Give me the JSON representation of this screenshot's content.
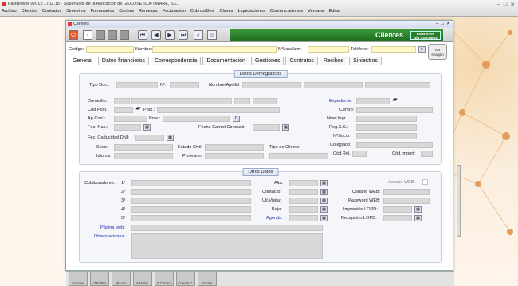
{
  "app": {
    "title": "FastBroker v2012.1702.15 - Supervisor de la Aplicación de GECOSE SOFTWARE, S.L.",
    "menu": [
      "Archivo",
      "Clientes",
      "Contratos",
      "Siniestros",
      "Formularios",
      "Cartera",
      "Remesas",
      "Facturación",
      "Cobros/Dev.",
      "Claves",
      "Liquidaciones",
      "Comunicaciones",
      "Ventana",
      "Editar"
    ]
  },
  "window": {
    "title": "Clientes",
    "header_label": "Clientes",
    "badge_line1": "Existentes",
    "badge_line2": "Sin Contratos",
    "photo_label_1": "Sin",
    "photo_label_2": "Imagen"
  },
  "top_fields": {
    "codigo": "Código:",
    "nombre": "Nombre:",
    "nlocalizacion": "NºLocalizm:",
    "telefono": "Teléfono:"
  },
  "tabs": [
    "General",
    "Datos financieros",
    "Correspondencia",
    "Documentación",
    "Gestiones",
    "Contratos",
    "Recibos",
    "Siniestros"
  ],
  "demograficos": {
    "title": "Datos Demográficos",
    "tipo_doc": "Tipo Doc.:",
    "n": "Nº:",
    "nombre_apellido": "Nombre/Apellid",
    "domicilio": "Domicilio:",
    "cod_post": "Cod Post.:",
    "pobl": "Pobl.:",
    "ap_corr": "Ap.Corr.:",
    "prov": "Prov.:",
    "fec_nac": "Fec. Nac.:",
    "fecha_carnet": "Fecha Carnet Conducir:",
    "fec_caducidad": "Fec. Caducidad DNI:",
    "sexo": "Sexo:",
    "estado_civil": "Estado Civil:",
    "tipo_cliente": "Tipo de Cliente:",
    "idioma": "Idioma:",
    "profesion": "Profesion:",
    "expediente": "Expediente:",
    "centro": "Centro:",
    "nivel_ingr": "Nivel Ingr.:",
    "reg_ss": "Reg.S.S.:",
    "nsocio": "NºSocio:",
    "colegiado": "Colegiado:",
    "cod_rel": "Cód.Rel.:",
    "cod_import": "Cód.Import:"
  },
  "otros": {
    "title": "Otros Datos",
    "colaboradores": "Colaboradores:",
    "c1": "1º",
    "c2": "2º",
    "c3": "3º",
    "c4": "4º",
    "c5": "5º",
    "alta": "Alta:",
    "contacto": "Contacto:",
    "ult_visita": "Últ.Visita:",
    "baja": "Baja:",
    "agenda": "Agenda:",
    "acceso_web": "Acceso WEB",
    "usuario_web": "Usuario WEB:",
    "password_web": "Password WEB:",
    "impresion_lopd": "Impresión LOPD:",
    "recepcion_lopd": "Recepción LOPD:",
    "pagina_web": "Página web:",
    "observaciones": "Observaciones:"
  },
  "taskbar": [
    "Scanner",
    "cliFolder",
    "Alta Co.",
    "Alta Sin.",
    "P.Control",
    "Cuenta C.",
    "Est.Sin."
  ]
}
